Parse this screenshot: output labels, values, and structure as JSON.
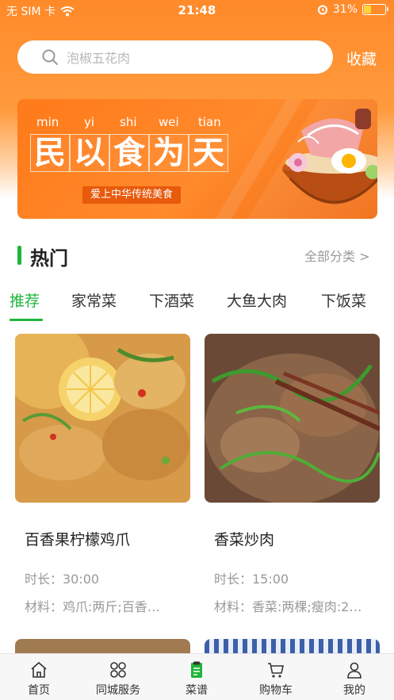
{
  "status_bar": {
    "carrier": "无 SIM 卡",
    "time": "21:48",
    "battery_text": "31%",
    "battery_level": 0.31
  },
  "search": {
    "placeholder": "泡椒五花肉"
  },
  "header": {
    "favorites_label": "收藏"
  },
  "banner": {
    "pinyin": [
      "min",
      "yi",
      "shi",
      "wei",
      "tian"
    ],
    "title_chars": [
      "民",
      "以",
      "食",
      "为",
      "天"
    ],
    "subtitle": "爱上中华传统美食"
  },
  "section": {
    "title": "热门",
    "all_categories": "全部分类 >"
  },
  "tabs": [
    {
      "label": "推荐",
      "active": true
    },
    {
      "label": "家常菜",
      "active": false
    },
    {
      "label": "下酒菜",
      "active": false
    },
    {
      "label": "大鱼大肉",
      "active": false
    },
    {
      "label": "下饭菜",
      "active": false
    }
  ],
  "recipes": [
    {
      "title": "百香果柠檬鸡爪",
      "duration": "时长：30:00",
      "ingredients": "材料：鸡爪:两斤;百香…"
    },
    {
      "title": "香菜炒肉",
      "duration": "时长：15:00",
      "ingredients": "材料：香菜:两棵;瘦肉:2…"
    }
  ],
  "bottom_nav": [
    {
      "label": "首页",
      "icon": "home-icon"
    },
    {
      "label": "同城服务",
      "icon": "grid-icon"
    },
    {
      "label": "菜谱",
      "icon": "recipe-icon"
    },
    {
      "label": "购物车",
      "icon": "cart-icon"
    },
    {
      "label": "我的",
      "icon": "user-icon"
    }
  ],
  "colors": {
    "accent": "#1eb53a",
    "header": "#ff8a2a"
  }
}
